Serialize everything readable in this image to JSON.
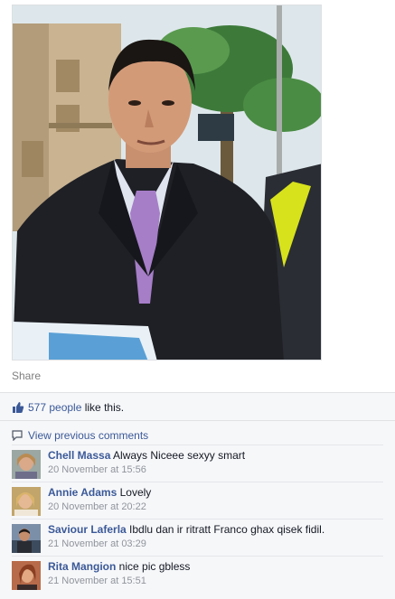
{
  "post": {
    "share_label": "Share",
    "likes": {
      "count": "577 people",
      "suffix": " like this."
    },
    "view_previous": "View previous comments"
  },
  "comments": [
    {
      "author": "Chell Massa",
      "text": "Always Niceee sexyy smart",
      "time": "20 November at 15:56"
    },
    {
      "author": "Annie Adams",
      "text": "Lovely",
      "time": "20 November at 20:22"
    },
    {
      "author": "Saviour Laferla",
      "text": "Ibdlu dan ir ritratt Franco ghax qisek fidil.",
      "time": "21 November at 03:29"
    },
    {
      "author": "Rita Mangion",
      "text": "nice pic gbless",
      "time": "21 November at 15:51"
    }
  ],
  "colors": {
    "link": "#3b5998",
    "muted": "#90949c",
    "panel": "#f6f7f9"
  },
  "icons": {
    "like": "thumbs-up-icon",
    "comment": "speech-bubble-icon"
  }
}
